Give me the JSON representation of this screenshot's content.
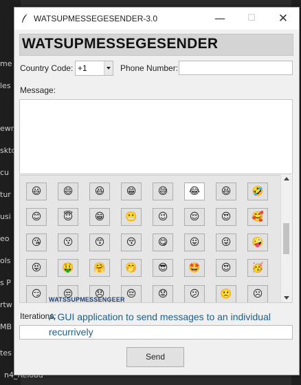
{
  "background": {
    "left_items": [
      "me",
      "les",
      "ewn",
      "skto",
      "cu",
      "tur",
      "usi",
      "eo",
      "ols",
      "s P",
      "rtw",
      "MB",
      "tes"
    ],
    "bottom_label": "n4_Reload"
  },
  "window": {
    "title": "WATSUPMESSEGESENDER-3.0",
    "minimize_symbol": "—",
    "maximize_symbol": "☐",
    "close_symbol": "✕"
  },
  "header": {
    "title": "WATSUPMESSEGESENDER"
  },
  "form": {
    "country_code_label": "Country Code:",
    "country_code_value": "+1",
    "phone_label": "Phone Number:",
    "phone_value": "",
    "message_label": "Message:",
    "message_value": "",
    "iterations_label": "Iterations:",
    "iterations_value": ""
  },
  "emoji_rows": [
    [
      "😃",
      "😄",
      "😆",
      "😁",
      "😅",
      "😂",
      "😆",
      "🤣"
    ],
    [
      "😊",
      "😇",
      "😁",
      "😬",
      "😉",
      "😌",
      "😍",
      "🥰"
    ],
    [
      "😘",
      "😗",
      "😙",
      "😚",
      "😋",
      "😛",
      "😜",
      "🤪"
    ],
    [
      "😝",
      "🤑",
      "🤗",
      "🤭",
      "😎",
      "🤩",
      "😍",
      "🥳"
    ],
    [
      "😏",
      "😒",
      "😞",
      "😔",
      "😟",
      "😕",
      "🙁",
      "☹"
    ]
  ],
  "overlay": {
    "app_name": "WATSSUPMESSENGEER",
    "description": "A GUI application to send messages to an individual recurrively"
  },
  "buttons": {
    "send": "Send"
  }
}
